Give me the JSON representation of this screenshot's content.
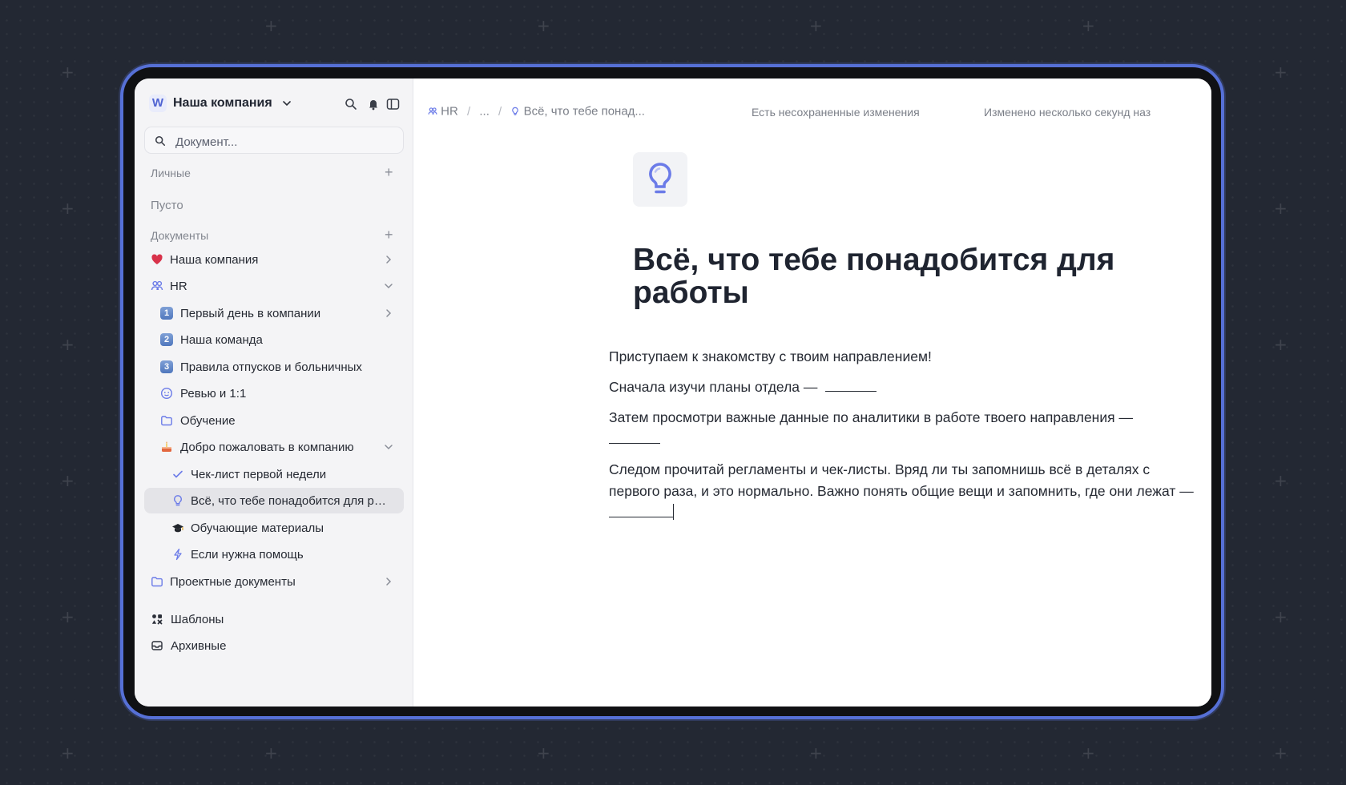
{
  "workspace": {
    "logo_letter": "W",
    "name": "Наша компания"
  },
  "header_icons": [
    "search-icon",
    "bell-icon",
    "sidebar-toggle-icon"
  ],
  "search": {
    "placeholder": "Документ..."
  },
  "sections": {
    "personal": {
      "label": "Личные",
      "empty_text": "Пусто"
    },
    "documents": {
      "label": "Документы"
    }
  },
  "tree": [
    {
      "label": "Наша компания",
      "icon": "heart-icon",
      "expander": "chevron-right"
    },
    {
      "label": "HR",
      "icon": "people-icon",
      "expander": "chevron-down"
    },
    {
      "label": "Первый день в компании",
      "icon": "keycap-1",
      "expander": "chevron-right"
    },
    {
      "label": "Наша команда",
      "icon": "keycap-2"
    },
    {
      "label": "Правила отпусков и больничных",
      "icon": "keycap-3"
    },
    {
      "label": "Ревью и 1:1",
      "icon": "smiley-icon"
    },
    {
      "label": "Обучение",
      "icon": "folder-icon"
    },
    {
      "label": "Добро пожаловать в компанию",
      "icon": "cake-icon",
      "expander": "chevron-down"
    },
    {
      "label": "Чек-лист первой недели",
      "icon": "check-icon"
    },
    {
      "label": "Всё, что тебе понадобится для работы",
      "icon": "lightbulb-icon",
      "active": true
    },
    {
      "label": "Обучающие материалы",
      "icon": "graduation-cap-icon"
    },
    {
      "label": "Если нужна помощь",
      "icon": "lightning-icon"
    },
    {
      "label": "Проектные документы",
      "icon": "folder-icon",
      "expander": "chevron-right"
    }
  ],
  "bottom_nav": [
    {
      "label": "Шаблоны",
      "icon": "templates-icon"
    },
    {
      "label": "Архивные",
      "icon": "archive-icon"
    }
  ],
  "breadcrumbs": {
    "first": "HR",
    "ellipsis": "...",
    "current": "Всё, что тебе понад..."
  },
  "status": {
    "unsaved": "Есть несохраненные изменения",
    "modified": "Изменено несколько секунд наз"
  },
  "document": {
    "icon": "lightbulb-icon",
    "title": "Всё, что тебе понадобится для работы",
    "paragraphs": [
      "Приступаем к знакомству с твоим направлением!",
      "Сначала изучи планы отдела —",
      "Затем просмотри важные данные по аналитики в работе твоего направления —",
      "Следом прочитай регламенты и чек-листы. Вряд ли ты запомнишь всё в деталях с первого раза, и это нормально. Важно понять общие вещи и запомнить, где они лежат —"
    ]
  },
  "colors": {
    "accent": "#5670d6",
    "background": "#232833",
    "sidebar": "#f4f4f6",
    "icon_blue": "#6b7be8"
  }
}
